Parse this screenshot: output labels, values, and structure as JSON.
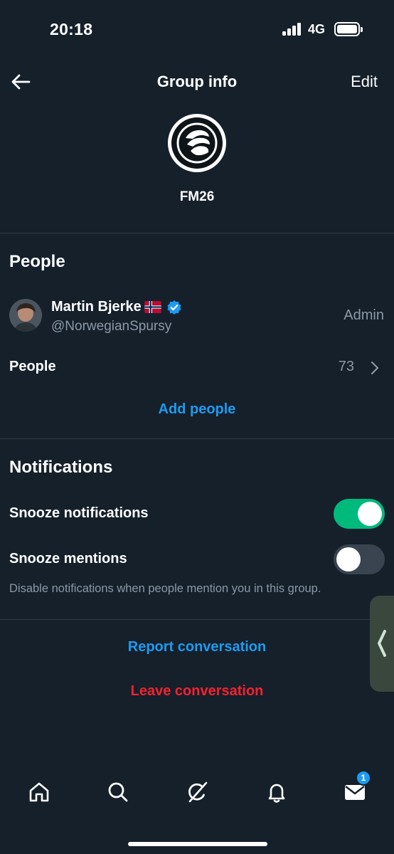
{
  "status_bar": {
    "time": "20:18",
    "network": "4G"
  },
  "header": {
    "title": "Group info",
    "edit_label": "Edit"
  },
  "group": {
    "name": "FM26"
  },
  "people_section": {
    "title": "People",
    "member": {
      "name": "Martin Bjerke",
      "handle": "@NorwegianSpursy",
      "role": "Admin"
    },
    "people_label": "People",
    "people_count": "73",
    "add_people_label": "Add people"
  },
  "notifications_section": {
    "title": "Notifications",
    "snooze_notifications": {
      "label": "Snooze notifications",
      "enabled": true
    },
    "snooze_mentions": {
      "label": "Snooze mentions",
      "enabled": false
    },
    "helper_text": "Disable notifications when people mention you in this group."
  },
  "actions": {
    "report_label": "Report conversation",
    "leave_label": "Leave conversation"
  },
  "bottom_nav": {
    "items": [
      "home",
      "search",
      "grok",
      "notifications",
      "messages"
    ],
    "messages_badge": "1"
  },
  "colors": {
    "background": "#15202b",
    "accent_blue": "#1d9bf0",
    "danger_red": "#f4212e",
    "toggle_on": "#00ba7c",
    "secondary_text": "#8b98a5"
  }
}
